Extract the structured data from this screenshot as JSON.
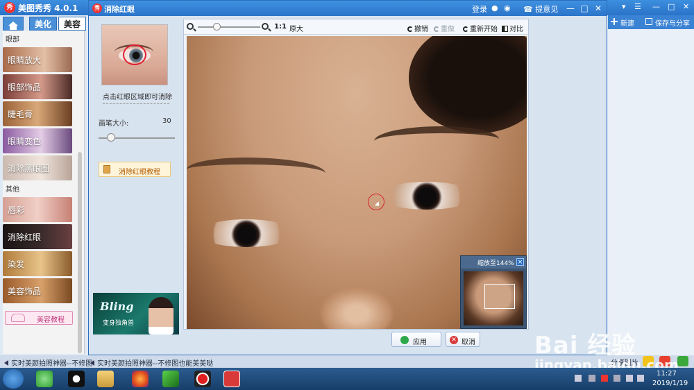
{
  "app": {
    "title": "美图秀秀 4.0.1",
    "logo": "秀",
    "tabs": [
      "美化",
      "美容"
    ],
    "sidebar": {
      "section_eyes": "眼部",
      "eye_items": [
        {
          "label": "眼睛放大",
          "color": "#c8906c"
        },
        {
          "label": "眼部饰品",
          "color": "#a8655a"
        },
        {
          "label": "睫毛膏",
          "color": "#b07a4a"
        },
        {
          "label": "眼睛变色",
          "color": "#9a6aa6"
        },
        {
          "label": "消除黑眼圈",
          "color": "#c9b4a6"
        }
      ],
      "section_other": "其他",
      "other_items": [
        {
          "label": "唇彩",
          "color": "#d89a8e"
        },
        {
          "label": "消除红眼",
          "color": "#3a2a2a"
        },
        {
          "label": "染发",
          "color": "#c28a4a"
        },
        {
          "label": "美容饰品",
          "color": "#a8703a"
        }
      ],
      "tutorial": "美容教程"
    },
    "right_panel": {
      "new_label": "新建",
      "save_label": "保存与分享"
    },
    "titlebar": {
      "login": "登录",
      "feedback": "提意见"
    },
    "status": {
      "marquee_left": "实时美颜拍照神器--不修图",
      "marquee_dialog": "实时美颜拍照神器--不修图也能美美哒",
      "share_label": "分享图片"
    }
  },
  "dialog": {
    "title": "消除红眼",
    "logo": "秀",
    "hint": "点击红眼区域即可消除",
    "brush_size_label": "画笔大小:",
    "brush_size_value": "30",
    "brush_size_level": 0.1,
    "tutorial_label": "消除红眼教程",
    "ad": {
      "title": "Bling",
      "subtitle": "变身独角兽"
    },
    "toolbar": {
      "ratio": "1:1",
      "original": "原大",
      "undo": "撤销",
      "redo": "重做",
      "reset": "重新开始",
      "compare": "对比",
      "zoom_level": 0.3
    },
    "navigator": {
      "title": "缩放至144%",
      "close": "×"
    },
    "apply_label": "应用",
    "cancel_label": "取消"
  },
  "watermark": {
    "logo": "Bai 经验",
    "url": "jingyan.baidu.com"
  },
  "taskbar": {
    "time": "11:27",
    "date": "2019/1/19"
  }
}
